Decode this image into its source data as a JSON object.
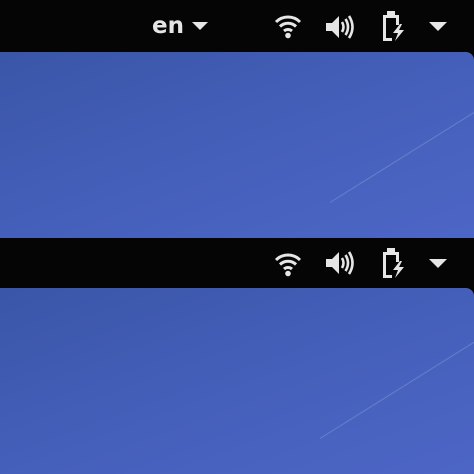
{
  "top_panel": {
    "language": {
      "label": "en"
    },
    "indicators": [
      "wifi-icon",
      "volume-icon",
      "battery-charging-icon",
      "system-menu-chevron-icon"
    ]
  },
  "bottom_panel": {
    "indicators": [
      "wifi-icon",
      "volume-icon",
      "battery-charging-icon",
      "system-menu-chevron-icon"
    ]
  },
  "colors": {
    "panel": "#050505",
    "desktop_gradient_start": "#3a56a8",
    "desktop_gradient_end": "#4d66c6",
    "icon": "#e6e6e6"
  }
}
